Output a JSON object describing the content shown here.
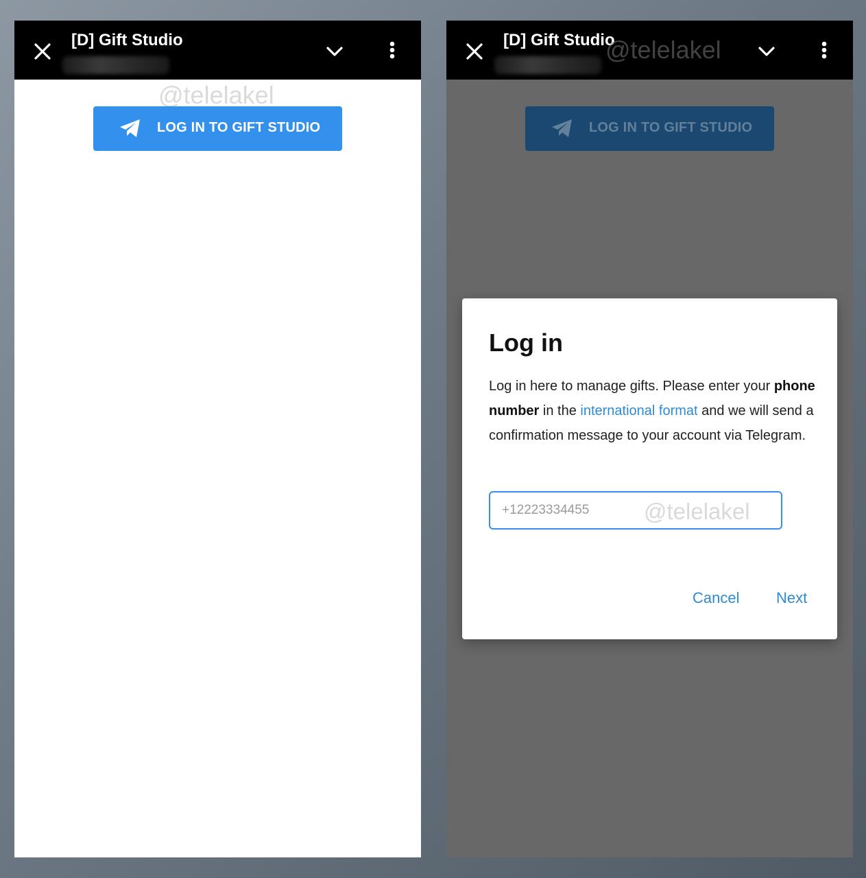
{
  "left_screen": {
    "header": {
      "title": "[D] Gift Studio"
    },
    "login_button_label": "LOG IN TO GIFT STUDIO",
    "watermark": "@telelakel"
  },
  "right_screen": {
    "header": {
      "title": "[D] Gift Studio"
    },
    "login_button_label": "LOG IN TO GIFT STUDIO",
    "watermark_header": "@telelakel",
    "watermark_input": "@telelakel",
    "dialog": {
      "title": "Log in",
      "text_before_bold": "Log in here to manage gifts. Please enter your ",
      "text_bold": "phone number",
      "text_mid": " in the ",
      "text_link": "international format",
      "text_after": " and we will send a confirmation message to your account via Telegram.",
      "phone_placeholder": "+12223334455",
      "cancel_label": "Cancel",
      "next_label": "Next"
    }
  },
  "colors": {
    "accent": "#3390ec",
    "link": "#2f8bd1",
    "header_bg": "#000000",
    "overlay_bg": "#686868"
  },
  "icons": {
    "close": "close-icon",
    "chevron": "chevron-down-icon",
    "more": "more-vertical-icon",
    "login": "telegram-plane-icon"
  }
}
